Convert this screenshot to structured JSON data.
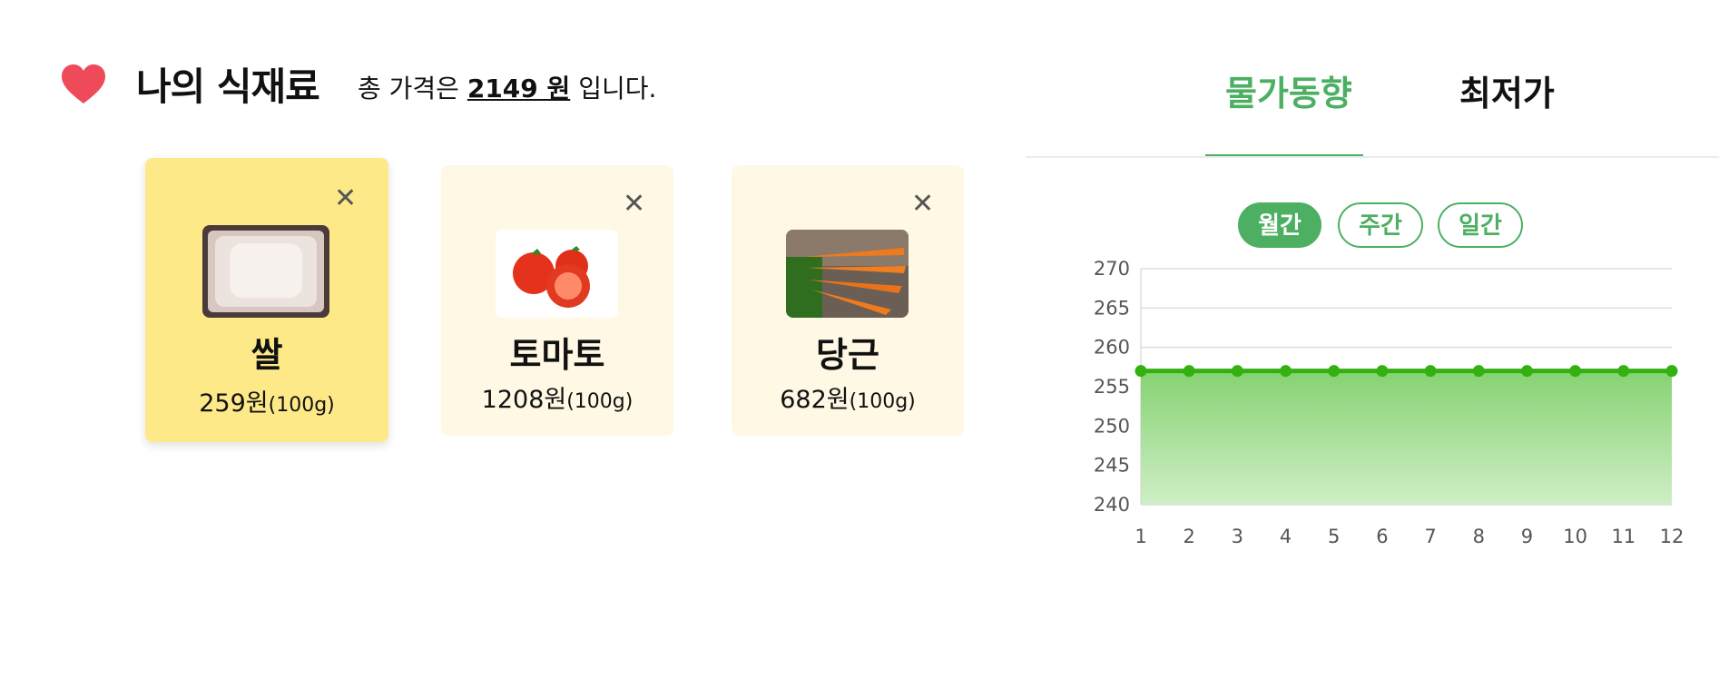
{
  "header": {
    "title": "나의 식재료",
    "summary_prefix": "총 가격은 ",
    "total_price": "2149 원",
    "summary_suffix": " 입니다."
  },
  "icons": {
    "heart": "heart-icon",
    "close": "close-icon"
  },
  "tabs": [
    {
      "label": "물가동향",
      "active": true
    },
    {
      "label": "최저가",
      "active": false
    }
  ],
  "ingredients": [
    {
      "name": "쌀",
      "price": "259원",
      "unit": "(100g)",
      "image": "rice-photo",
      "selected": true
    },
    {
      "name": "토마토",
      "price": "1208원",
      "unit": "(100g)",
      "image": "tomato-photo",
      "selected": false
    },
    {
      "name": "당근",
      "price": "682원",
      "unit": "(100g)",
      "image": "carrot-photo",
      "selected": false
    }
  ],
  "periods": [
    {
      "label": "월간",
      "active": true
    },
    {
      "label": "주간",
      "active": false
    },
    {
      "label": "일간",
      "active": false
    }
  ],
  "colors": {
    "accent": "#4caf62",
    "selected_card": "#fee989",
    "card": "#fef8e4",
    "heart": "#ef4a5a",
    "line": "#33b10f"
  },
  "chart_data": {
    "type": "area",
    "x": [
      1,
      2,
      3,
      4,
      5,
      6,
      7,
      8,
      9,
      10,
      11,
      12
    ],
    "series": [
      {
        "values": [
          257,
          257,
          257,
          257,
          257,
          257,
          257,
          257,
          257,
          257,
          257,
          257
        ]
      }
    ],
    "yticks": [
      240,
      245,
      250,
      255,
      260,
      265,
      270
    ],
    "ylim": [
      240,
      270
    ],
    "grid": true
  }
}
